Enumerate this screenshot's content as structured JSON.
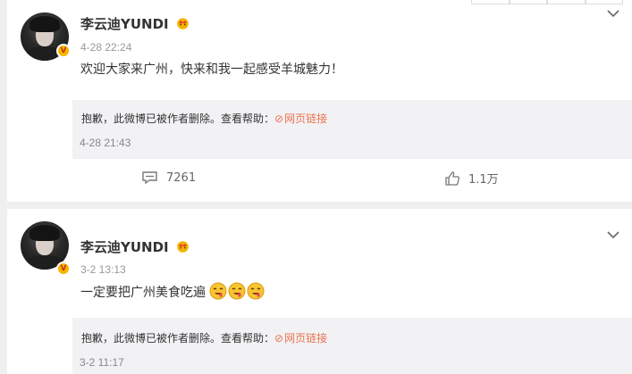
{
  "posts": [
    {
      "username": "李云迪YUNDI",
      "time": "4-28 22:24",
      "text": "欢迎大家来广州，快来和我一起感受羊城魅力！",
      "repost": {
        "notice_prefix": "抱歉，此微博已被作者删除。查看帮助：",
        "link_label": "网页链接",
        "time": "4-28 21:43"
      },
      "comments_count": "7261",
      "likes_count": "1.1万"
    },
    {
      "username": "李云迪YUNDI",
      "time": "3-2 13:13",
      "text": "一定要把广州美食吃遍",
      "emojis": [
        "drooling-emoji",
        "drooling-emoji",
        "drooling-emoji"
      ],
      "repost": {
        "notice_prefix": "抱歉，此微博已被作者删除。查看帮助：",
        "link_label": "网页链接",
        "time": "3-2 11:17"
      }
    }
  ],
  "colors": {
    "background": "#efefef",
    "link": "#eb7350",
    "repost_bg": "#f2f2f5",
    "verified_badge": "#f7b500"
  }
}
